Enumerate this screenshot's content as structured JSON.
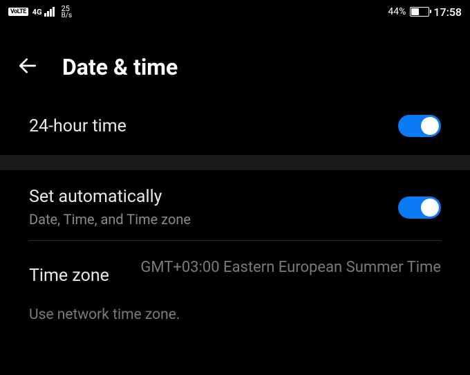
{
  "status": {
    "volte": "VoLTE",
    "network": "4G",
    "speed_value": "25",
    "speed_unit": "B/s",
    "battery_pct": "44%",
    "time": "17:58"
  },
  "header": {
    "title": "Date & time"
  },
  "settings": {
    "hour24": {
      "label": "24-hour time",
      "enabled": true
    },
    "auto": {
      "label": "Set automatically",
      "sublabel": "Date, Time, and Time zone",
      "enabled": true
    },
    "timezone": {
      "label": "Time zone",
      "value": "GMT+03:00 Eastern European Summer Time"
    },
    "hint": "Use network time zone."
  }
}
